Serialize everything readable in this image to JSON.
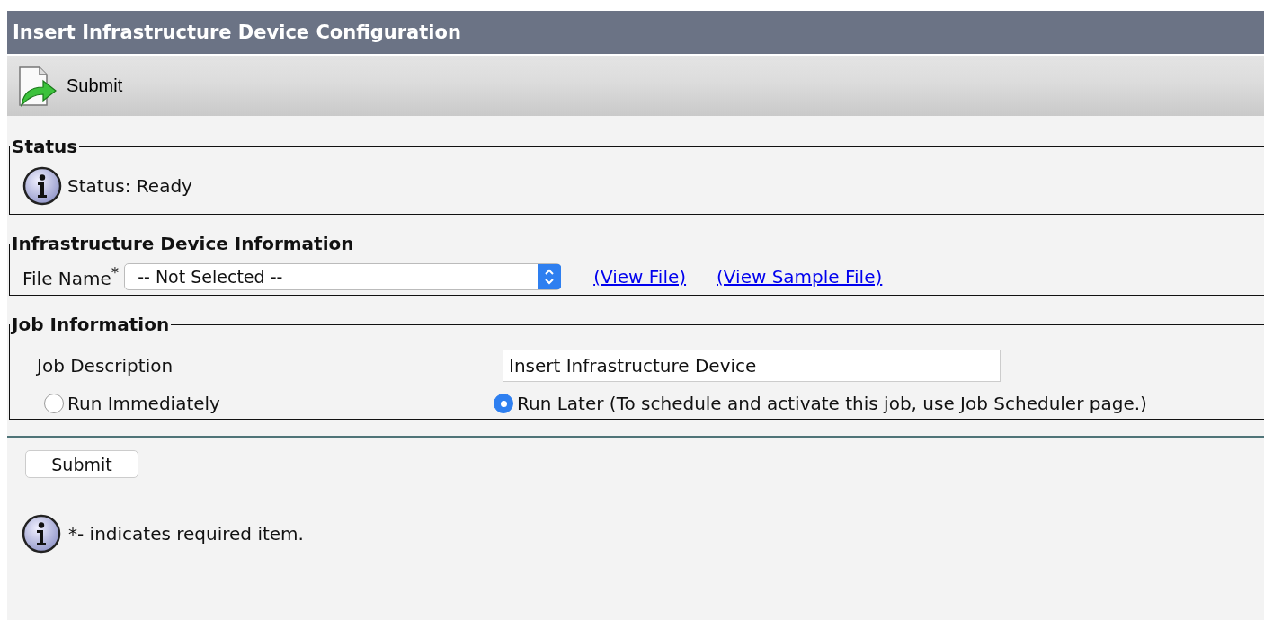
{
  "window": {
    "title": "Insert Infrastructure Device Configuration"
  },
  "toolbar": {
    "buttons": [
      {
        "label": "Submit"
      }
    ]
  },
  "status": {
    "legend": "Status",
    "message": "Status: Ready"
  },
  "device_info": {
    "legend": "Infrastructure Device Information",
    "file_name": {
      "label": "File Name$^{*}$",
      "value": "-- Not Selected --"
    },
    "links": [
      "(View File)",
      "(View Sample File)"
    ]
  },
  "job_info": {
    "legend": "Job Information",
    "description": {
      "label": "Job Description",
      "value": "Insert Infrastructure Device"
    },
    "run_options": [
      {
        "label": "Run Immediately",
        "selected": false
      },
      {
        "label": "Run Later (To schedule and activate this job, use Job Scheduler page.)",
        "selected": true
      }
    ]
  },
  "submit_button": "Submit",
  "footnote": "*- indicates required item."
}
